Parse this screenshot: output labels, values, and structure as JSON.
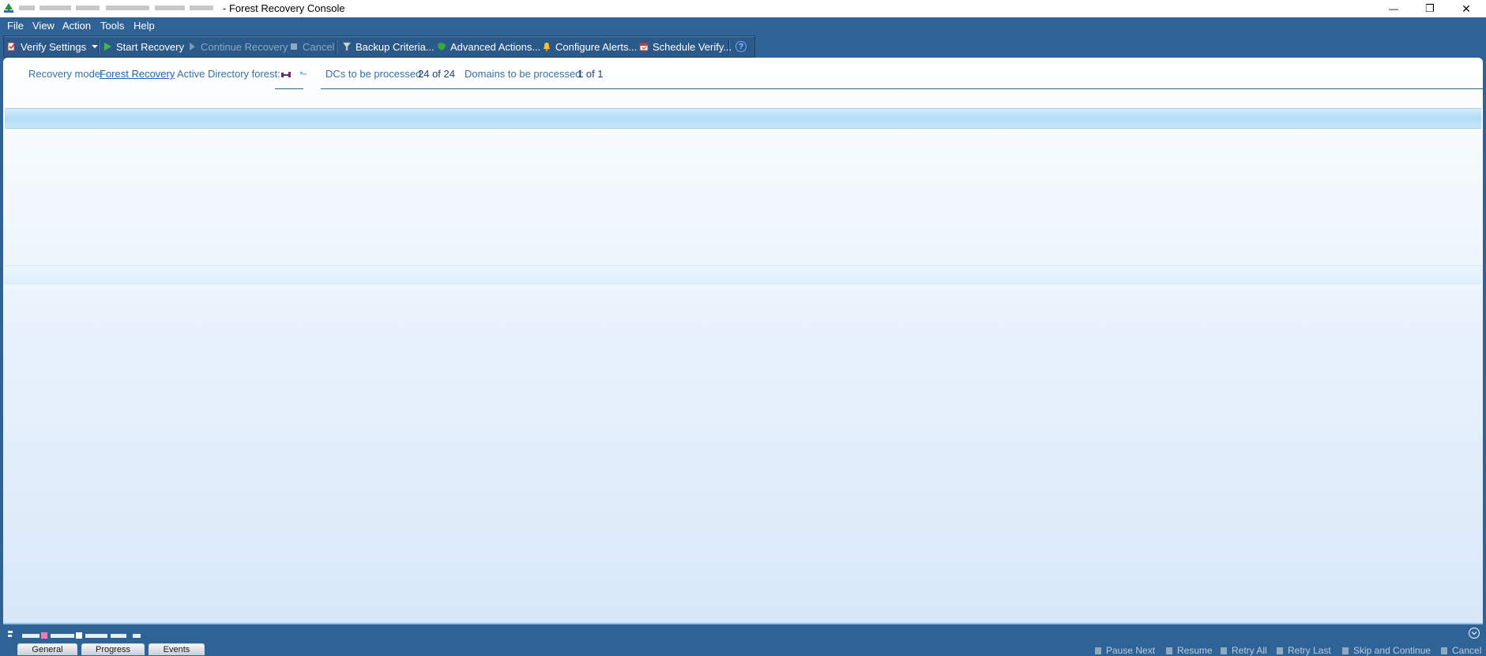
{
  "window": {
    "title": "- Forest Recovery Console",
    "minimize_glyph": "—",
    "restore_glyph": "❐",
    "close_glyph": "✕"
  },
  "menu": [
    "File",
    "View",
    "Action",
    "Tools",
    "Help"
  ],
  "toolbar": {
    "verify_settings": "Verify Settings",
    "start_recovery": "Start Recovery",
    "continue_recovery": "Continue Recovery",
    "cancel": "Cancel",
    "backup_criteria": "Backup Criteria...",
    "advanced_actions": "Advanced Actions...",
    "configure_alerts": "Configure Alerts...",
    "schedule_verify": "Schedule Verify...",
    "help_glyph": "?"
  },
  "summary": {
    "recovery_mode_label": "Recovery mode:",
    "recovery_mode_value": "Forest Recovery",
    "ad_forest_label": "Active Directory forest:",
    "dcs_label": "DCs to be processed:",
    "dcs_value": "24 of 24",
    "domains_label": "Domains to be processed:",
    "domains_value": "1 of 1"
  },
  "bottom_tabs": [
    "General",
    "Progress",
    "Events"
  ],
  "bottom_actions": [
    "Pause Next",
    "Resume",
    "Retry All",
    "Retry Last",
    "Skip and Continue",
    "Cancel"
  ],
  "colors": {
    "chrome_blue": "#2f6396",
    "label_blue": "#3a6fa3",
    "value_navy": "#1f3f78",
    "link_blue": "#1f5fb3"
  },
  "icons": {
    "app": "forest-recovery-app-icon",
    "verify": "verify-settings-icon",
    "start": "play-icon",
    "continue": "continue-icon",
    "cancel": "stop-icon",
    "backup": "filter-icon",
    "advanced": "shield-icon",
    "alerts": "bell-icon",
    "schedule": "calendar-icon",
    "help": "help-icon"
  }
}
